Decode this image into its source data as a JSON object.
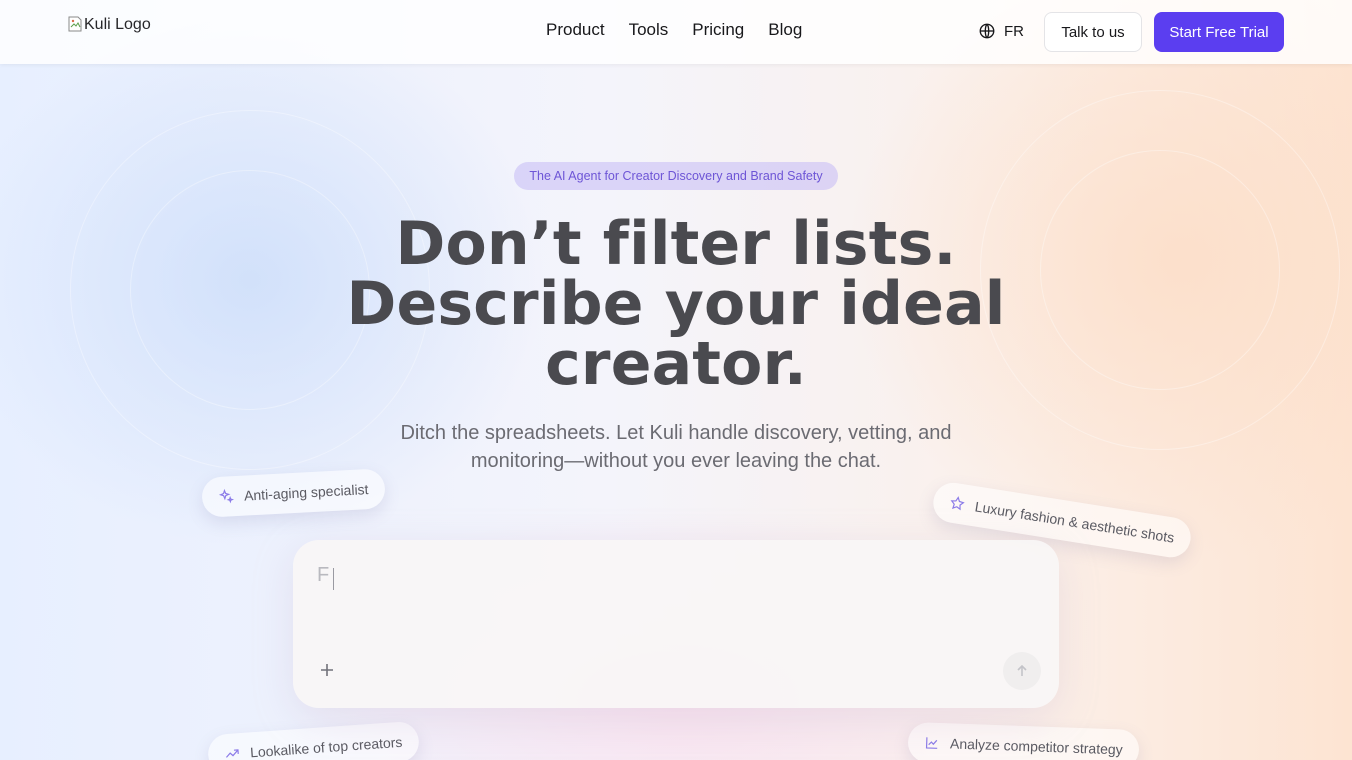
{
  "header": {
    "logo_alt": "Kuli Logo",
    "nav": [
      "Product",
      "Tools",
      "Pricing",
      "Blog"
    ],
    "language": "FR",
    "talk_button": "Talk to us",
    "trial_button": "Start Free Trial"
  },
  "hero": {
    "badge": "The AI Agent for Creator Discovery and Brand Safety",
    "headline_lines": [
      "Don’t filter lists.",
      "Describe your ideal",
      "creator."
    ],
    "subtitle_lines": [
      "Ditch the spreadsheets. Let Kuli handle discovery, vetting, and",
      "monitoring—without you ever leaving the chat."
    ]
  },
  "chips": [
    {
      "label": "Anti-aging specialist",
      "icon": "sparkle-icon"
    },
    {
      "label": "Luxury fashion & aesthetic shots",
      "icon": "star-icon"
    },
    {
      "label": "Lookalike of top creators",
      "icon": "trend-icon"
    },
    {
      "label": "Analyze competitor strategy",
      "icon": "chart-icon"
    }
  ],
  "chat": {
    "typed_text": "F"
  },
  "colors": {
    "accent": "#5b3ef0",
    "badge_text": "#6d55d6",
    "headline": "#4a4a4f"
  }
}
